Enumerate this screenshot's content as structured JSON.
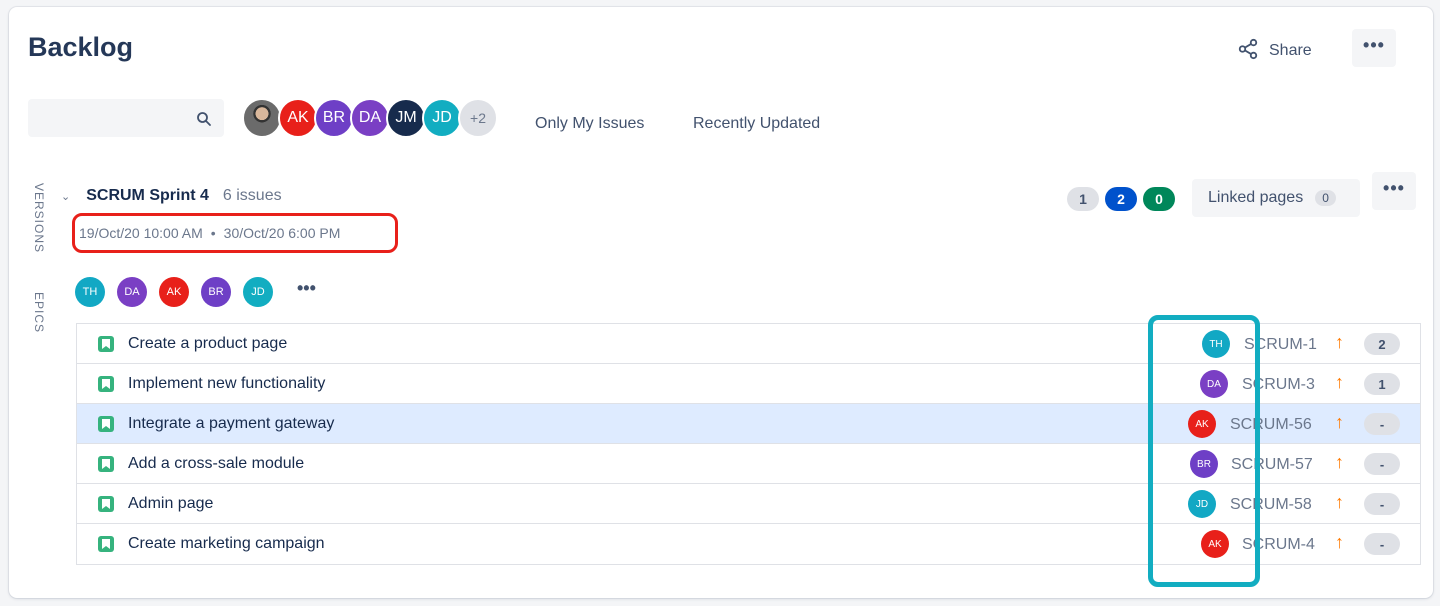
{
  "header": {
    "title": "Backlog",
    "share_label": "Share",
    "more_label": "•••"
  },
  "toolbar": {
    "search_placeholder": "",
    "avatars": [
      {
        "initials": "",
        "color": "#6b6b6b",
        "kind": "photo"
      },
      {
        "initials": "AK",
        "color": "#e8201a"
      },
      {
        "initials": "BR",
        "color": "#6e3fc6"
      },
      {
        "initials": "DA",
        "color": "#7a3fc4"
      },
      {
        "initials": "JM",
        "color": "#172b4d"
      },
      {
        "initials": "JD",
        "color": "#12adc1"
      }
    ],
    "more_avatars": "+2",
    "filters": [
      "Only My Issues",
      "Recently Updated"
    ]
  },
  "side_tabs": [
    "VERSIONS",
    "EPICS"
  ],
  "sprint": {
    "collapse_icon": "chevron-down-icon",
    "name": "SCRUM Sprint 4",
    "issue_count": "6 issues",
    "start": "19/Oct/20 10:00 AM",
    "separator": "•",
    "end": "30/Oct/20 6:00 PM",
    "members": [
      {
        "initials": "TH",
        "color": "#12a8c4"
      },
      {
        "initials": "DA",
        "color": "#7a3fc4"
      },
      {
        "initials": "AK",
        "color": "#e8201a"
      },
      {
        "initials": "BR",
        "color": "#6e3fc6"
      },
      {
        "initials": "JD",
        "color": "#12adc1"
      }
    ],
    "members_more": "•••",
    "status_counts": [
      {
        "value": "1",
        "bg": "#dfe1e6",
        "fg": "#42526e"
      },
      {
        "value": "2",
        "bg": "#0052cc",
        "fg": "#ffffff"
      },
      {
        "value": "0",
        "bg": "#00875a",
        "fg": "#ffffff"
      }
    ],
    "linked_pages_label": "Linked pages",
    "linked_pages_count": "0",
    "more_label": "•••"
  },
  "issues": [
    {
      "summary": "Create a product page",
      "assignee": "TH",
      "assignee_color": "#12a8c4",
      "key": "SCRUM-1",
      "priority": "↑",
      "estimate": "2"
    },
    {
      "summary": "Implement new functionality",
      "assignee": "DA",
      "assignee_color": "#7a3fc4",
      "key": "SCRUM-3",
      "priority": "↑",
      "estimate": "1"
    },
    {
      "summary": "Integrate a payment gateway",
      "assignee": "AK",
      "assignee_color": "#e8201a",
      "key": "SCRUM-56",
      "priority": "↑",
      "estimate": "-"
    },
    {
      "summary": "Add a cross-sale module",
      "assignee": "BR",
      "assignee_color": "#6e3fc6",
      "key": "SCRUM-57",
      "priority": "↑",
      "estimate": "-"
    },
    {
      "summary": "Admin page",
      "assignee": "JD",
      "assignee_color": "#12a8c4",
      "key": "SCRUM-58",
      "priority": "↑",
      "estimate": "-"
    },
    {
      "summary": "Create marketing campaign",
      "assignee": "AK",
      "assignee_color": "#e8201a",
      "key": "SCRUM-4",
      "priority": "↑",
      "estimate": "-"
    }
  ],
  "colors": {
    "accent": "#0052cc",
    "highlight_red": "#e8201a",
    "highlight_teal": "#12adc1",
    "selected_row": "#deebff",
    "story_green": "#36b37e",
    "priority_orange": "#ff7a00"
  }
}
